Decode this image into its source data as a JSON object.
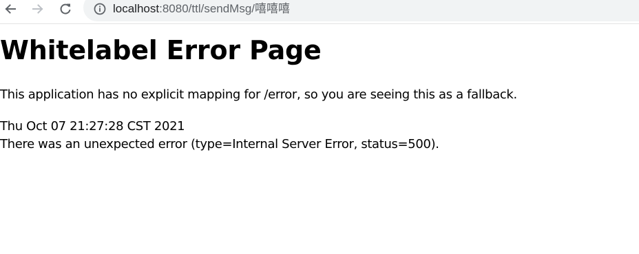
{
  "browser": {
    "url_host": "localhost",
    "url_path": ":8080/ttl/sendMsg/嘻嘻嘻",
    "icons": {
      "back": "back-arrow-icon",
      "forward": "forward-arrow-icon",
      "reload": "reload-icon",
      "info": "info-icon"
    },
    "colors": {
      "omnibox_bg": "#f1f3f4",
      "icon_active": "#5f6368",
      "icon_disabled": "#bdc1c6"
    }
  },
  "page": {
    "title": "Whitelabel Error Page",
    "message": "This application has no explicit mapping for /error, so you are seeing this as a fallback.",
    "timestamp": "Thu Oct 07 21:27:28 CST 2021",
    "error_detail": "There was an unexpected error (type=Internal Server Error, status=500)."
  }
}
